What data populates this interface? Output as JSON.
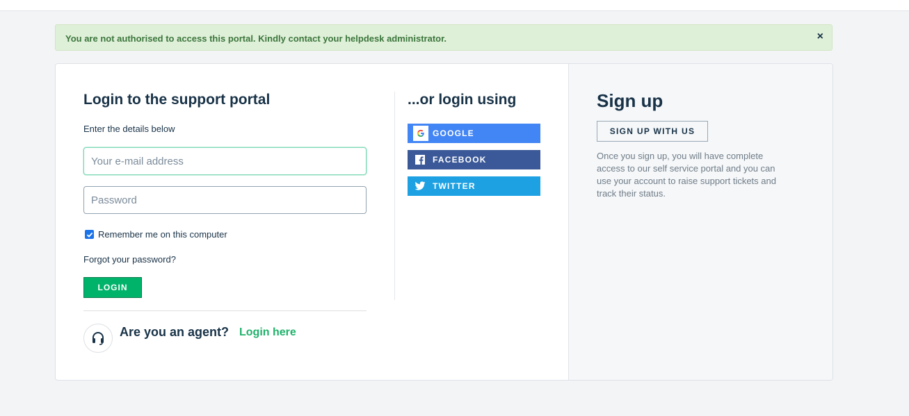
{
  "alert": {
    "message": "You are not authorised to access this portal. Kindly contact your helpdesk administrator.",
    "close_glyph": "×",
    "color": "#3c763d"
  },
  "login": {
    "title": "Login to the support portal",
    "subtitle": "Enter the details below",
    "email_placeholder": "Your e-mail address",
    "password_placeholder": "Password",
    "remember_label": "Remember me on this computer",
    "remember_checked": true,
    "forgot_label": "Forgot your password?",
    "button_label": "LOGIN"
  },
  "agent": {
    "icon": "headset-icon",
    "question": "Are you an agent?",
    "link_label": "Login here"
  },
  "social": {
    "title": "...or login using",
    "buttons": [
      {
        "label": "GOOGLE",
        "icon": "google-icon",
        "color": "#4285f4"
      },
      {
        "label": "FACEBOOK",
        "icon": "facebook-icon",
        "color": "#3b5998"
      },
      {
        "label": "TWITTER",
        "icon": "twitter-icon",
        "color": "#1da1e2"
      }
    ]
  },
  "signup": {
    "title": "Sign up",
    "button_label": "SIGN UP WITH US",
    "description": "Once you sign up, you will have complete access to our self service portal and you can use your account to raise support tickets and track their status."
  }
}
